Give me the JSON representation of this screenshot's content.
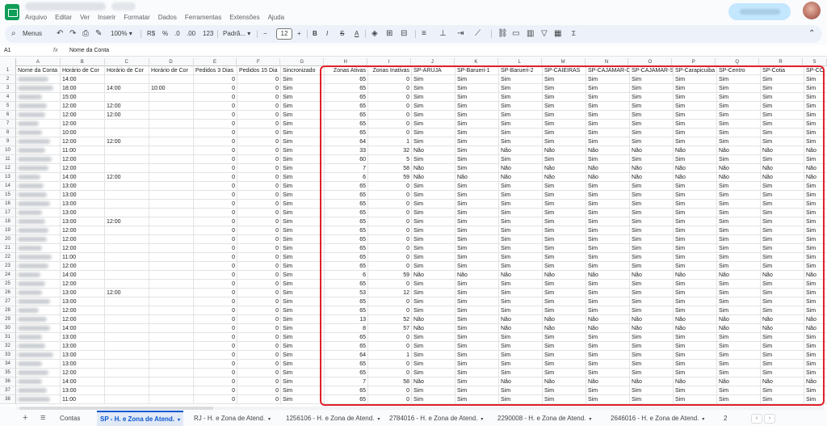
{
  "app": {
    "menu": [
      "Arquivo",
      "Editar",
      "Ver",
      "Inserir",
      "Formatar",
      "Dados",
      "Ferramentas",
      "Extensões",
      "Ajuda"
    ]
  },
  "toolbar": {
    "search_label": "Menus",
    "zoom": "100%",
    "currency": "R$",
    "percent": "%",
    "decimal_decrease": ".0",
    "decimal_increase": ".00",
    "number_format": "123",
    "font": "Padrã...",
    "font_size": "12",
    "bold": "B",
    "italic": "I",
    "strikethrough": "S",
    "text_color": "A",
    "sigma": "Σ"
  },
  "formula_bar": {
    "cell_ref": "A1",
    "fx": "fx",
    "content": "Nome da Conta"
  },
  "columns": [
    "A",
    "B",
    "C",
    "D",
    "E",
    "F",
    "G",
    "H",
    "I",
    "J",
    "K",
    "L",
    "M",
    "N",
    "O",
    "P",
    "Q",
    "R",
    "S"
  ],
  "headers": [
    "Nome da Conta",
    "Horário de Cor",
    "Horário de Cor",
    "Horário de Cor",
    "Pedidos 3 Dias",
    "Pedidos 15 Dia",
    "Sincronizado",
    "Zonas Ativas",
    "Zonas Inativas",
    "SP-ARUJA",
    "SP-Barueri-1",
    "SP-Barueri-2",
    "SP-CAIEIRAS",
    "SP-CAJAMAR-C",
    "SP-CAJAMAR-S",
    "SP-Carapicuiba",
    "SP-Centro",
    "SP-Cotia",
    "SP-CO"
  ],
  "rows": [
    {
      "n": "2",
      "b": "14:00",
      "c": "",
      "d": "",
      "ativas": "65",
      "inativas": "0",
      "zones": "SSSSSSSSSS"
    },
    {
      "n": "3",
      "b": "18:00",
      "c": "14:00",
      "d": "10:00",
      "ativas": "65",
      "inativas": "0",
      "zones": "SSSSSSSSSS"
    },
    {
      "n": "4",
      "b": "15:00",
      "c": "",
      "d": "",
      "ativas": "65",
      "inativas": "0",
      "zones": "SSSSSSSSSS"
    },
    {
      "n": "5",
      "b": "12:00",
      "c": "12:00",
      "d": "",
      "ativas": "65",
      "inativas": "0",
      "zones": "SSSSSSSSSS"
    },
    {
      "n": "6",
      "b": "12:00",
      "c": "12:00",
      "d": "",
      "ativas": "65",
      "inativas": "0",
      "zones": "SSSSSSSSSS"
    },
    {
      "n": "7",
      "b": "12:00",
      "c": "",
      "d": "",
      "ativas": "65",
      "inativas": "0",
      "zones": "SSSSSSSSSS"
    },
    {
      "n": "8",
      "b": "10:00",
      "c": "",
      "d": "",
      "ativas": "65",
      "inativas": "0",
      "zones": "SSSSSSSSSS"
    },
    {
      "n": "9",
      "b": "12:00",
      "c": "12:00",
      "d": "",
      "ativas": "64",
      "inativas": "1",
      "zones": "SSSSSSSSSS"
    },
    {
      "n": "10",
      "b": "11:00",
      "c": "",
      "d": "",
      "ativas": "33",
      "inativas": "32",
      "zones": "NSNNNNNNNN"
    },
    {
      "n": "11",
      "b": "12:00",
      "c": "",
      "d": "",
      "ativas": "60",
      "inativas": "5",
      "zones": "SSSSSSSSSS"
    },
    {
      "n": "12",
      "b": "12:00",
      "c": "",
      "d": "",
      "ativas": "7",
      "inativas": "58",
      "zones": "NSNNNNNNNN"
    },
    {
      "n": "13",
      "b": "14:00",
      "c": "12:00",
      "d": "",
      "ativas": "6",
      "inativas": "59",
      "zones": "NNNNNNNNNN"
    },
    {
      "n": "14",
      "b": "13:00",
      "c": "",
      "d": "",
      "ativas": "65",
      "inativas": "0",
      "zones": "SSSSSSSSSS"
    },
    {
      "n": "15",
      "b": "13:00",
      "c": "",
      "d": "",
      "ativas": "65",
      "inativas": "0",
      "zones": "SSSSSSSSSS"
    },
    {
      "n": "16",
      "b": "13:00",
      "c": "",
      "d": "",
      "ativas": "65",
      "inativas": "0",
      "zones": "SSSSSSSSSS"
    },
    {
      "n": "17",
      "b": "13:00",
      "c": "",
      "d": "",
      "ativas": "65",
      "inativas": "0",
      "zones": "SSSSSSSSSS"
    },
    {
      "n": "18",
      "b": "13:00",
      "c": "12:00",
      "d": "",
      "ativas": "65",
      "inativas": "0",
      "zones": "SSSSSSSSSS"
    },
    {
      "n": "19",
      "b": "12:00",
      "c": "",
      "d": "",
      "ativas": "65",
      "inativas": "0",
      "zones": "SSSSSSSSSS"
    },
    {
      "n": "20",
      "b": "12:00",
      "c": "",
      "d": "",
      "ativas": "65",
      "inativas": "0",
      "zones": "SSSSSSSSSS"
    },
    {
      "n": "21",
      "b": "12:00",
      "c": "",
      "d": "",
      "ativas": "65",
      "inativas": "0",
      "zones": "SSSSSSSSSS"
    },
    {
      "n": "22",
      "b": "11:00",
      "c": "",
      "d": "",
      "ativas": "65",
      "inativas": "0",
      "zones": "SSSSSSSSSS"
    },
    {
      "n": "23",
      "b": "12:00",
      "c": "",
      "d": "",
      "ativas": "65",
      "inativas": "0",
      "zones": "SSSSSSSSSS"
    },
    {
      "n": "24",
      "b": "14:00",
      "c": "",
      "d": "",
      "ativas": "6",
      "inativas": "59",
      "zones": "NNNNNNNNNN"
    },
    {
      "n": "25",
      "b": "12:00",
      "c": "",
      "d": "",
      "ativas": "65",
      "inativas": "0",
      "zones": "SSSSSSSSSS"
    },
    {
      "n": "26",
      "b": "13:00",
      "c": "12:00",
      "d": "",
      "ativas": "53",
      "inativas": "12",
      "zones": "SSSSSSSSSS"
    },
    {
      "n": "27",
      "b": "13:00",
      "c": "",
      "d": "",
      "ativas": "65",
      "inativas": "0",
      "zones": "SSSSSSSSSS"
    },
    {
      "n": "28",
      "b": "12:00",
      "c": "",
      "d": "",
      "ativas": "65",
      "inativas": "0",
      "zones": "SSSSSSSSSS"
    },
    {
      "n": "29",
      "b": "12:00",
      "c": "",
      "d": "",
      "ativas": "13",
      "inativas": "52",
      "zones": "NSNNNNNNNN"
    },
    {
      "n": "30",
      "b": "14:00",
      "c": "",
      "d": "",
      "ativas": "8",
      "inativas": "57",
      "zones": "NSNNNNNNNN"
    },
    {
      "n": "31",
      "b": "13:00",
      "c": "",
      "d": "",
      "ativas": "65",
      "inativas": "0",
      "zones": "SSSSSSSSSS"
    },
    {
      "n": "32",
      "b": "13:00",
      "c": "",
      "d": "",
      "ativas": "65",
      "inativas": "0",
      "zones": "SSSSSSSSSS"
    },
    {
      "n": "33",
      "b": "13:00",
      "c": "",
      "d": "",
      "ativas": "64",
      "inativas": "1",
      "zones": "SSSSSSSSSS"
    },
    {
      "n": "34",
      "b": "13:00",
      "c": "",
      "d": "",
      "ativas": "65",
      "inativas": "0",
      "zones": "SSSSSSSSSS"
    },
    {
      "n": "35",
      "b": "12:00",
      "c": "",
      "d": "",
      "ativas": "65",
      "inativas": "0",
      "zones": "SSSSSSSSSS"
    },
    {
      "n": "36",
      "b": "14:00",
      "c": "",
      "d": "",
      "ativas": "7",
      "inativas": "58",
      "zones": "NSNNNNNNNN"
    },
    {
      "n": "37",
      "b": "13:00",
      "c": "",
      "d": "",
      "ativas": "65",
      "inativas": "0",
      "zones": "SSSSSSSSSS"
    },
    {
      "n": "38",
      "b": "11:00",
      "c": "",
      "d": "",
      "ativas": "65",
      "inativas": "0",
      "zones": "SSSSSSSSSS"
    }
  ],
  "values": {
    "sim": "Sim",
    "nao": "Não",
    "zero": "0"
  },
  "sheets": {
    "add": "+",
    "list": "≡",
    "tabs": [
      {
        "label": "Contas",
        "active": false
      },
      {
        "label": "SP - H. e Zona de Atend.",
        "active": true
      },
      {
        "label": "RJ - H. e Zona de Atend.",
        "active": false
      },
      {
        "label": "1256106 - H. e Zona de Atend.",
        "active": false
      },
      {
        "label": "2784016 - H. e Zona de Atend.",
        "active": false
      },
      {
        "label": "2290008 - H. e Zona de Atend.",
        "active": false
      },
      {
        "label": "2646016 - H. e Zona de Atend.",
        "active": false
      },
      {
        "label": "2",
        "active": false
      }
    ],
    "prev": "‹",
    "next": "›"
  },
  "colors": {
    "highlight": "#e0202a",
    "accent": "#0b57d0"
  }
}
